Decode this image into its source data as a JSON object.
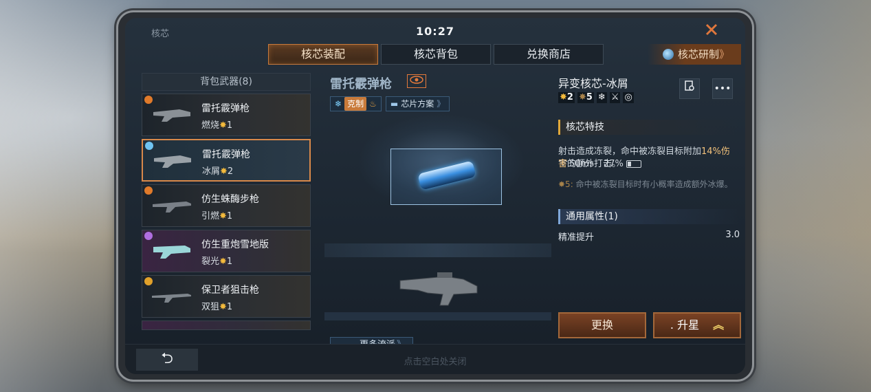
{
  "status": {
    "crumb": "核芯",
    "time": "10:27",
    "ping": "50ms",
    "battery": "27%"
  },
  "tabs": [
    {
      "label": "核芯装配",
      "active": true
    },
    {
      "label": "核芯背包"
    },
    {
      "label": "兑换商店"
    }
  ],
  "research": {
    "label": "核芯研制",
    "chevron": "》"
  },
  "backpack": {
    "header": "背包武器(8)",
    "items": [
      {
        "name": "雷托霰弹枪",
        "attr": "燃烧",
        "star": "✸",
        "level": "1",
        "element": "fire"
      },
      {
        "name": "雷托霰弹枪",
        "attr": "冰屑",
        "star": "✸",
        "level": "2",
        "element": "ice",
        "selected": true
      },
      {
        "name": "仿生蛛酶步枪",
        "attr": "引燃",
        "star": "✸",
        "level": "1",
        "element": "fire"
      },
      {
        "name": "仿生重炮雪地版",
        "attr": "裂光",
        "star": "✸",
        "level": "1",
        "element": "purple"
      },
      {
        "name": "保卫者狙击枪",
        "attr": "双狙",
        "star": "✸",
        "level": "1",
        "element": "gold"
      }
    ]
  },
  "weapon": {
    "name": "雷托霰弹枪",
    "counter_label": "克制",
    "chip_plan": "芯片方案",
    "chevron": "》",
    "more_label": "更多流派"
  },
  "core": {
    "name": "异变核芯-冰屑",
    "stars": [
      {
        "icon": "✸",
        "value": "2"
      },
      {
        "icon": "✸",
        "value": "5"
      }
    ],
    "skill_title": "核芯特技",
    "desc_a": "射击造成冻裂，命中被冻裂目标附加",
    "desc_highlight": "14%伤害",
    "desc_b": "的额外打击。",
    "note_star": "✸5:",
    "note": "命中被冻裂目标时有小概率造成额外冰爆。",
    "attr_title": "通用属性(1)",
    "attrs": [
      {
        "name": "精准提升",
        "value": "3.0"
      }
    ],
    "replace_label": "更换",
    "upstar_label": "升星",
    "upstar_prefix": ".",
    "upstar_chevron": "︽"
  },
  "bottom": {
    "back_glyph": "⮌",
    "hint": "点击空白处关闭"
  },
  "colors": {
    "accent": "#d9894a",
    "star": "#f2b93c",
    "ice": "#7fd2ff"
  }
}
